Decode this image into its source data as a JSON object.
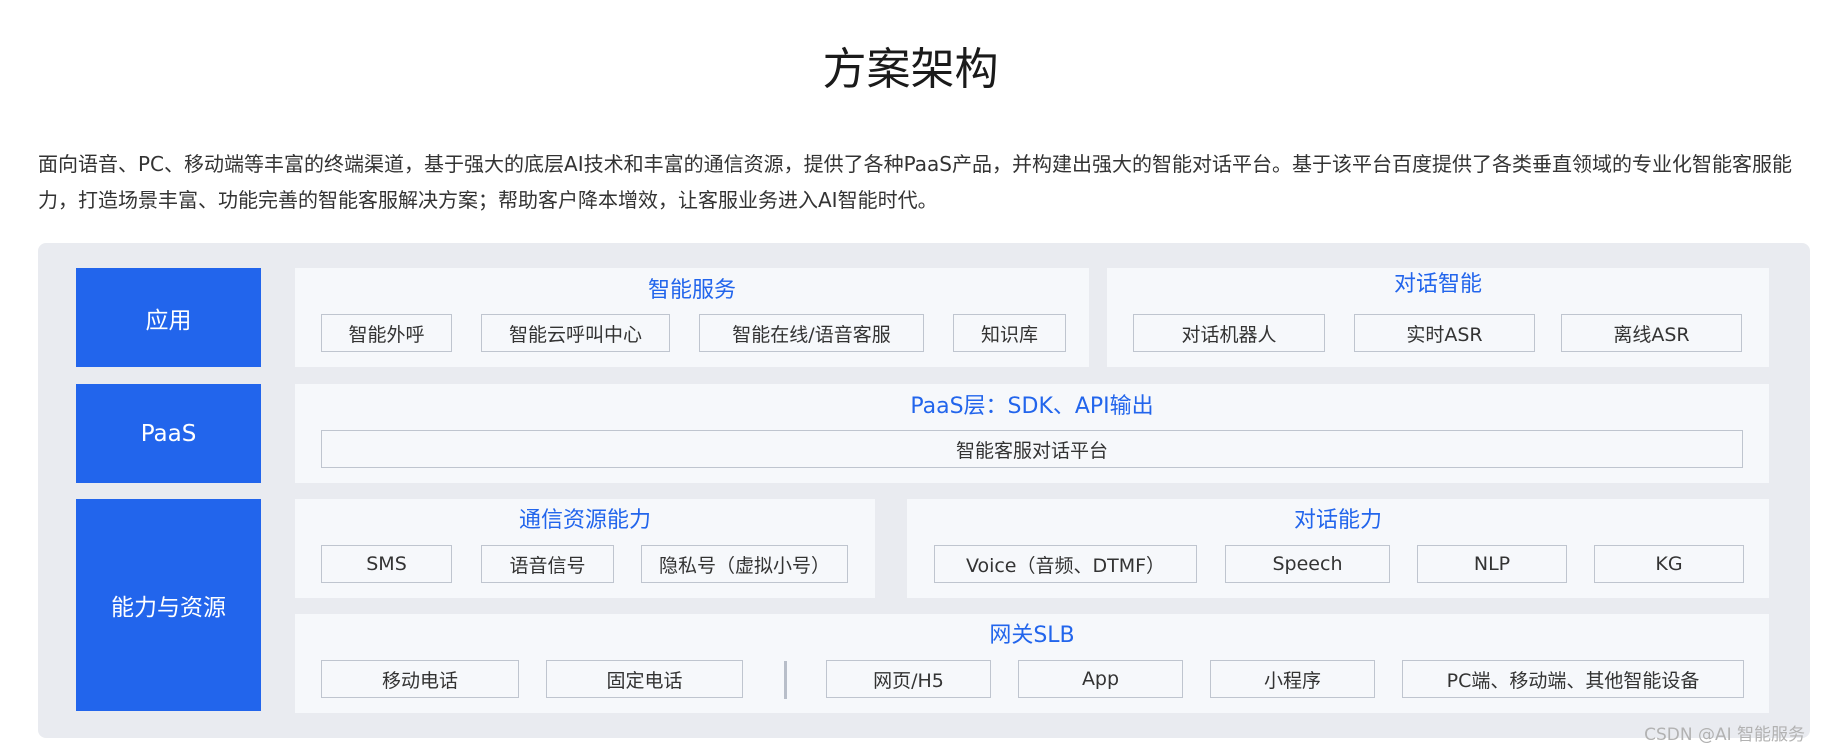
{
  "title": "方案架构",
  "description": "面向语音、PC、移动端等丰富的终端渠道，基于强大的底层AI技术和丰富的通信资源，提供了各种PaaS产品，并构建出强大的智能对话平台。基于该平台百度提供了各类垂直领域的专业化智能客服能力，打造场景丰富、功能完善的智能客服解决方案；帮助客户降本增效，让客服业务进入AI智能时代。",
  "layers": {
    "app": "应用",
    "paas": "PaaS",
    "capability": "能力与资源"
  },
  "app_layer": {
    "smart_service": {
      "heading": "智能服务",
      "items": [
        "智能外呼",
        "智能云呼叫中心",
        "智能在线/语音客服",
        "知识库"
      ]
    },
    "dialog_intelligence": {
      "heading": "对话智能",
      "items": [
        "对话机器人",
        "实时ASR",
        "离线ASR"
      ]
    }
  },
  "paas_layer": {
    "heading": "PaaS层：SDK、API输出",
    "platform": "智能客服对话平台"
  },
  "capability_layer": {
    "comm": {
      "heading": "通信资源能力",
      "items": [
        "SMS",
        "语音信号",
        "隐私号（虚拟小号）"
      ]
    },
    "dialog": {
      "heading": "对话能力",
      "items": [
        "Voice（音频、DTMF）",
        "Speech",
        "NLP",
        "KG"
      ]
    },
    "gateway": {
      "heading": "网关SLB",
      "phone_items": [
        "移动电话",
        "固定电话"
      ],
      "digital_items": [
        "网页/H5",
        "App",
        "小程序",
        "PC端、移动端、其他智能设备"
      ]
    }
  },
  "watermark": "CSDN @AI 智能服务"
}
